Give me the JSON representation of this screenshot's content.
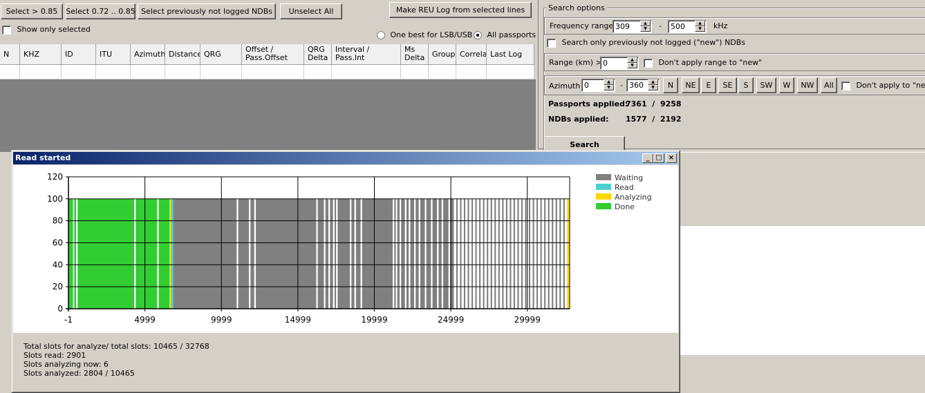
{
  "toolbar": {
    "select_gt": "Select > 0.85",
    "select_range": "Select 0.72 .. 0.85",
    "select_not_logged": "Select previously not logged NDBs",
    "unselect_all": "Unselect All",
    "make_log": "Make REU Log from selected lines",
    "show_only_selected": "Show only selected",
    "one_best": "One best for LSB/USB",
    "all_passports": "All passports"
  },
  "grid": {
    "columns": [
      {
        "label": "N"
      },
      {
        "label": "KHZ"
      },
      {
        "label": "ID"
      },
      {
        "label": "ITU"
      },
      {
        "label": "Azimuth"
      },
      {
        "label": "Distance"
      },
      {
        "label": "QRG"
      },
      {
        "label": "Offset /\nPass.Offset"
      },
      {
        "label": "QRG\nDelta"
      },
      {
        "label": "Interval /\nPass.Int"
      },
      {
        "label": "Ms\nDelta"
      },
      {
        "label": "Group"
      },
      {
        "label": "Correlat"
      },
      {
        "label": "Last Log"
      }
    ]
  },
  "search": {
    "group_title": "Search options",
    "freq_label": "Frequency range:",
    "freq_from": "309",
    "freq_sep": "-",
    "freq_to": "500",
    "freq_unit": "kHz",
    "only_not_logged": "Search only previously not logged (\"new\") NDBs",
    "range_label": "Range (km) >",
    "range_value": "0",
    "range_no_new": "Don't apply range to \"new\"",
    "azimuth_label": "Azimuth",
    "az_from": "0",
    "az_sep": "-",
    "az_to": "360",
    "directions": [
      "N",
      "NE",
      "E",
      "SE",
      "S",
      "SW",
      "W",
      "NW",
      "All"
    ],
    "az_no_new": "Don't apply to \"new\"",
    "passports_label": "Passports applied:",
    "passports_value": "7361  /  9258",
    "ndbs_label": "NDBs applied:",
    "ndbs_value": "1577  /  2192",
    "search_button": "Search"
  },
  "read_window": {
    "title": "Read started",
    "stats": [
      "Total slots for analyze/ total slots: 10465 / 32768",
      "Slots read: 2901",
      "Slots analyzing now: 6",
      "Slots analyzed: 2804 / 10465"
    ]
  },
  "chart_data": {
    "type": "bar",
    "ylim": [
      0,
      120
    ],
    "xlim": [
      -1,
      32767
    ],
    "yticks": [
      0,
      20,
      40,
      60,
      80,
      100,
      120
    ],
    "xticks": [
      "-1",
      "4999",
      "9999",
      "14999",
      "19999",
      "24999",
      "29999"
    ],
    "grid": true,
    "legend_position": "right",
    "colors": {
      "Waiting": "#808080",
      "Read": "#4fd0d0",
      "Analyzing": "#ffd700",
      "Done": "#32cd32",
      "Empty": "#ffffff"
    },
    "series": [
      {
        "name": "Waiting"
      },
      {
        "name": "Read"
      },
      {
        "name": "Analyzing"
      },
      {
        "name": "Done"
      }
    ],
    "bar_value": 100,
    "segments": [
      {
        "state": "Done",
        "from": -1,
        "to": 300
      },
      {
        "state": "Empty",
        "from": 300,
        "to": 380
      },
      {
        "state": "Done",
        "from": 380,
        "to": 500
      },
      {
        "state": "Empty",
        "from": 500,
        "to": 600
      },
      {
        "state": "Done",
        "from": 600,
        "to": 4300
      },
      {
        "state": "Empty",
        "from": 4300,
        "to": 4400
      },
      {
        "state": "Done",
        "from": 4400,
        "to": 5800
      },
      {
        "state": "Empty",
        "from": 5800,
        "to": 5900
      },
      {
        "state": "Done",
        "from": 5900,
        "to": 6600
      },
      {
        "state": "Analyzing",
        "from": 6600,
        "to": 6700
      },
      {
        "state": "Read",
        "from": 6700,
        "to": 6850
      },
      {
        "state": "Waiting",
        "from": 6850,
        "to": 11000
      },
      {
        "state": "Empty",
        "from": 11000,
        "to": 11100
      },
      {
        "state": "Waiting",
        "from": 11100,
        "to": 11800
      },
      {
        "state": "Empty",
        "from": 11800,
        "to": 11900
      },
      {
        "state": "Waiting",
        "from": 11900,
        "to": 12150
      },
      {
        "state": "Empty",
        "from": 12150,
        "to": 12250
      },
      {
        "state": "Waiting",
        "from": 12250,
        "to": 16200
      },
      {
        "state": "Empty",
        "from": 16200,
        "to": 16300
      },
      {
        "state": "Waiting",
        "from": 16300,
        "to": 16700
      },
      {
        "state": "Empty",
        "from": 16700,
        "to": 16800
      },
      {
        "state": "Waiting",
        "from": 16800,
        "to": 17000
      },
      {
        "state": "Empty",
        "from": 17000,
        "to": 17100
      },
      {
        "state": "Waiting",
        "from": 17100,
        "to": 17300
      },
      {
        "state": "Empty",
        "from": 17300,
        "to": 17400
      },
      {
        "state": "Waiting",
        "from": 17400,
        "to": 17500
      },
      {
        "state": "Empty",
        "from": 17500,
        "to": 17600
      },
      {
        "state": "Waiting",
        "from": 17600,
        "to": 18400
      },
      {
        "state": "Empty",
        "from": 18400,
        "to": 18500
      },
      {
        "state": "Waiting",
        "from": 18500,
        "to": 18700
      },
      {
        "state": "Empty",
        "from": 18700,
        "to": 18800
      },
      {
        "state": "Waiting",
        "from": 18800,
        "to": 19100
      },
      {
        "state": "Empty",
        "from": 19100,
        "to": 19200
      },
      {
        "state": "Waiting",
        "from": 19200,
        "to": 21200
      },
      {
        "state": "Empty",
        "from": 21200,
        "to": 21300
      },
      {
        "state": "Waiting",
        "from": 21300,
        "to": 21400
      },
      {
        "state": "Empty",
        "from": 21400,
        "to": 21500
      },
      {
        "state": "Waiting",
        "from": 21500,
        "to": 21650
      },
      {
        "state": "Empty",
        "from": 21650,
        "to": 21750
      },
      {
        "state": "Waiting",
        "from": 21750,
        "to": 22000
      },
      {
        "state": "Empty",
        "from": 22000,
        "to": 22100
      },
      {
        "state": "Waiting",
        "from": 22100,
        "to": 22250
      },
      {
        "state": "Empty",
        "from": 22250,
        "to": 22350
      },
      {
        "state": "Waiting",
        "from": 22350,
        "to": 22600
      },
      {
        "state": "Empty",
        "from": 22600,
        "to": 22700
      },
      {
        "state": "Waiting",
        "from": 22700,
        "to": 22900
      },
      {
        "state": "Empty",
        "from": 22900,
        "to": 23000
      },
      {
        "state": "Waiting",
        "from": 23000,
        "to": 23300
      },
      {
        "state": "Empty",
        "from": 23300,
        "to": 23400
      },
      {
        "state": "Waiting",
        "from": 23400,
        "to": 23700
      },
      {
        "state": "Empty",
        "from": 23700,
        "to": 23800
      },
      {
        "state": "Waiting",
        "from": 23800,
        "to": 24100
      },
      {
        "state": "Empty",
        "from": 24100,
        "to": 24200
      },
      {
        "state": "Waiting",
        "from": 24200,
        "to": 24400
      },
      {
        "state": "Empty",
        "from": 24400,
        "to": 24500
      },
      {
        "state": "Waiting",
        "from": 24500,
        "to": 24850
      },
      {
        "state": "Empty",
        "from": 24850,
        "to": 24950
      },
      {
        "state": "Waiting",
        "from": 24950,
        "to": 25200
      },
      {
        "state": "Empty",
        "from": 25200,
        "to": 25350
      },
      {
        "state": "Waiting",
        "from": 25350,
        "to": 25450
      },
      {
        "state": "Empty",
        "from": 25450,
        "to": 25600
      },
      {
        "state": "Waiting",
        "from": 25600,
        "to": 25700
      },
      {
        "state": "Empty",
        "from": 25700,
        "to": 25850
      },
      {
        "state": "Waiting",
        "from": 25850,
        "to": 25950
      },
      {
        "state": "Empty",
        "from": 25950,
        "to": 26100
      },
      {
        "state": "Waiting",
        "from": 26100,
        "to": 26200
      },
      {
        "state": "Empty",
        "from": 26200,
        "to": 26350
      },
      {
        "state": "Waiting",
        "from": 26350,
        "to": 26450
      },
      {
        "state": "Empty",
        "from": 26450,
        "to": 26600
      },
      {
        "state": "Waiting",
        "from": 26600,
        "to": 26700
      },
      {
        "state": "Empty",
        "from": 26700,
        "to": 26850
      },
      {
        "state": "Waiting",
        "from": 26850,
        "to": 26950
      },
      {
        "state": "Empty",
        "from": 26950,
        "to": 27100
      },
      {
        "state": "Waiting",
        "from": 27100,
        "to": 27200
      },
      {
        "state": "Empty",
        "from": 27200,
        "to": 27350
      },
      {
        "state": "Waiting",
        "from": 27350,
        "to": 27450
      },
      {
        "state": "Empty",
        "from": 27450,
        "to": 27600
      },
      {
        "state": "Waiting",
        "from": 27600,
        "to": 27700
      },
      {
        "state": "Empty",
        "from": 27700,
        "to": 27850
      },
      {
        "state": "Waiting",
        "from": 27850,
        "to": 27950
      },
      {
        "state": "Empty",
        "from": 27950,
        "to": 28100
      },
      {
        "state": "Waiting",
        "from": 28100,
        "to": 28200
      },
      {
        "state": "Empty",
        "from": 28200,
        "to": 28350
      },
      {
        "state": "Waiting",
        "from": 28350,
        "to": 28450
      },
      {
        "state": "Empty",
        "from": 28450,
        "to": 28600
      },
      {
        "state": "Waiting",
        "from": 28600,
        "to": 28700
      },
      {
        "state": "Empty",
        "from": 28700,
        "to": 28850
      },
      {
        "state": "Waiting",
        "from": 28850,
        "to": 28950
      },
      {
        "state": "Empty",
        "from": 28950,
        "to": 29100
      },
      {
        "state": "Waiting",
        "from": 29100,
        "to": 29200
      },
      {
        "state": "Empty",
        "from": 29200,
        "to": 29350
      },
      {
        "state": "Waiting",
        "from": 29350,
        "to": 29450
      },
      {
        "state": "Empty",
        "from": 29450,
        "to": 29600
      },
      {
        "state": "Waiting",
        "from": 29600,
        "to": 29700
      },
      {
        "state": "Empty",
        "from": 29700,
        "to": 29850
      },
      {
        "state": "Waiting",
        "from": 29850,
        "to": 29950
      },
      {
        "state": "Empty",
        "from": 29950,
        "to": 30100
      },
      {
        "state": "Waiting",
        "from": 30100,
        "to": 30200
      },
      {
        "state": "Empty",
        "from": 30200,
        "to": 30350
      },
      {
        "state": "Waiting",
        "from": 30350,
        "to": 30450
      },
      {
        "state": "Empty",
        "from": 30450,
        "to": 30600
      },
      {
        "state": "Waiting",
        "from": 30600,
        "to": 30700
      },
      {
        "state": "Empty",
        "from": 30700,
        "to": 30850
      },
      {
        "state": "Waiting",
        "from": 30850,
        "to": 30950
      },
      {
        "state": "Empty",
        "from": 30950,
        "to": 31100
      },
      {
        "state": "Waiting",
        "from": 31100,
        "to": 31200
      },
      {
        "state": "Empty",
        "from": 31200,
        "to": 31350
      },
      {
        "state": "Waiting",
        "from": 31350,
        "to": 31450
      },
      {
        "state": "Empty",
        "from": 31450,
        "to": 31600
      },
      {
        "state": "Waiting",
        "from": 31600,
        "to": 31700
      },
      {
        "state": "Empty",
        "from": 31700,
        "to": 31850
      },
      {
        "state": "Waiting",
        "from": 31850,
        "to": 31950
      },
      {
        "state": "Empty",
        "from": 31950,
        "to": 32100
      },
      {
        "state": "Waiting",
        "from": 32100,
        "to": 32200
      },
      {
        "state": "Empty",
        "from": 32200,
        "to": 32350
      },
      {
        "state": "Waiting",
        "from": 32350,
        "to": 32450
      },
      {
        "state": "Empty",
        "from": 32450,
        "to": 32600
      },
      {
        "state": "Analyzing",
        "from": 32600,
        "to": 32767
      }
    ]
  }
}
